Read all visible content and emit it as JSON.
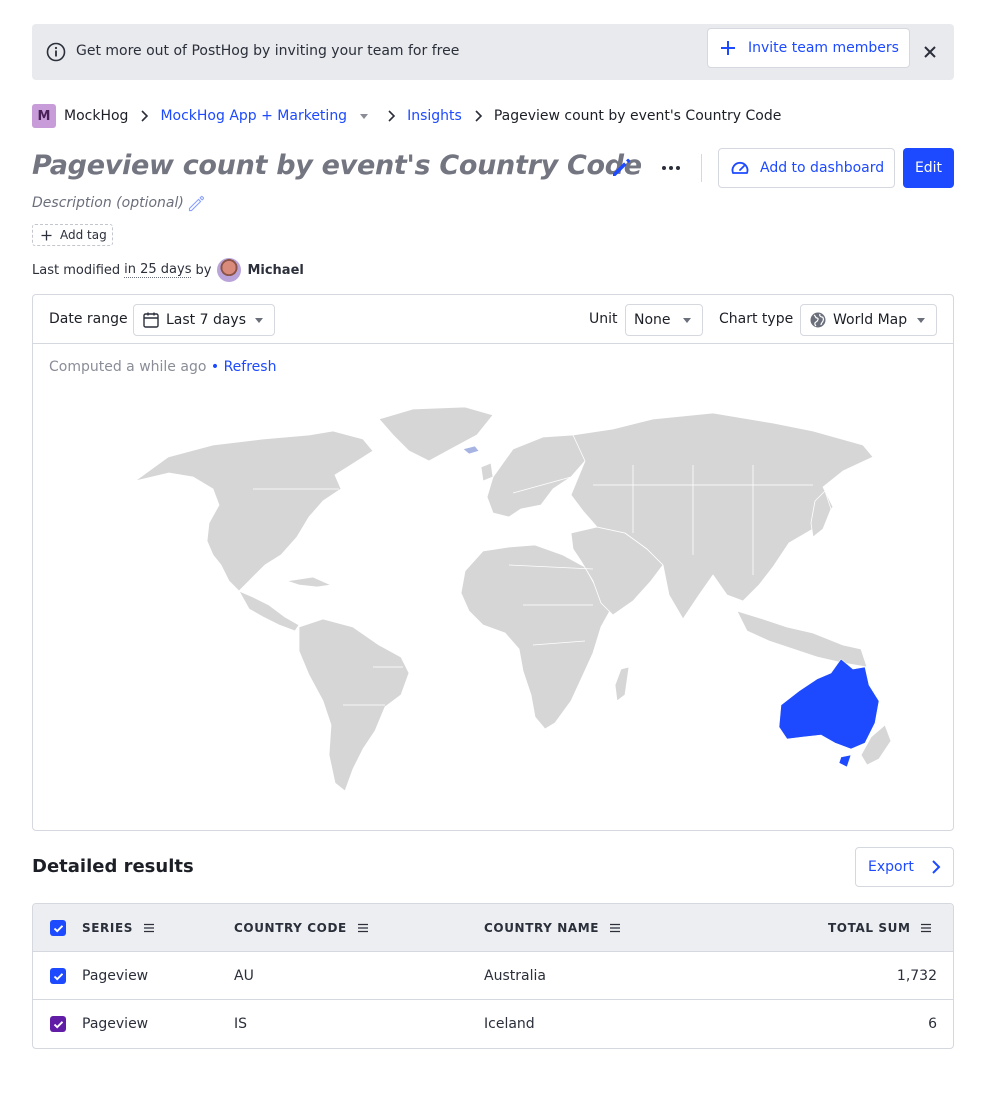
{
  "banner": {
    "text": "Get more out of PostHog by inviting your team for free",
    "invite_label": "Invite team members"
  },
  "breadcrumb": {
    "org_initial": "M",
    "org": "MockHog",
    "project": "MockHog App + Marketing",
    "section": "Insights",
    "current": "Pageview count by event's Country Code"
  },
  "insight": {
    "title": "Pageview count by event's Country Code",
    "description_placeholder": "Description (optional)",
    "add_tag_label": "Add tag",
    "add_to_dashboard_label": "Add to dashboard",
    "edit_label": "Edit",
    "modified_prefix": "Last modified",
    "modified_relative": "in 25 days",
    "modified_by": "by",
    "author": "Michael"
  },
  "toolbar": {
    "date_range_label": "Date range",
    "date_range_value": "Last 7 days",
    "unit_label": "Unit",
    "unit_value": "None",
    "chart_type_label": "Chart type",
    "chart_type_value": "World Map"
  },
  "status": {
    "computed_text": "Computed a while ago",
    "separator": "•",
    "refresh_label": "Refresh"
  },
  "chart_data": {
    "type": "map",
    "regions": [
      {
        "code": "AU",
        "name": "Australia",
        "value": 1732
      },
      {
        "code": "IS",
        "name": "Iceland",
        "value": 6
      }
    ],
    "highlight_color": "#1d4aff",
    "base_color": "#d6d6d6"
  },
  "results": {
    "title": "Detailed results",
    "export_label": "Export",
    "columns": [
      "SERIES",
      "COUNTRY CODE",
      "COUNTRY NAME",
      "TOTAL SUM"
    ],
    "rows": [
      {
        "series": "Pageview",
        "code": "AU",
        "name": "Australia",
        "total": "1,732",
        "checkbox_color": "#1d4aff"
      },
      {
        "series": "Pageview",
        "code": "IS",
        "name": "Iceland",
        "total": "6",
        "checkbox_color": "#621da6"
      }
    ]
  }
}
